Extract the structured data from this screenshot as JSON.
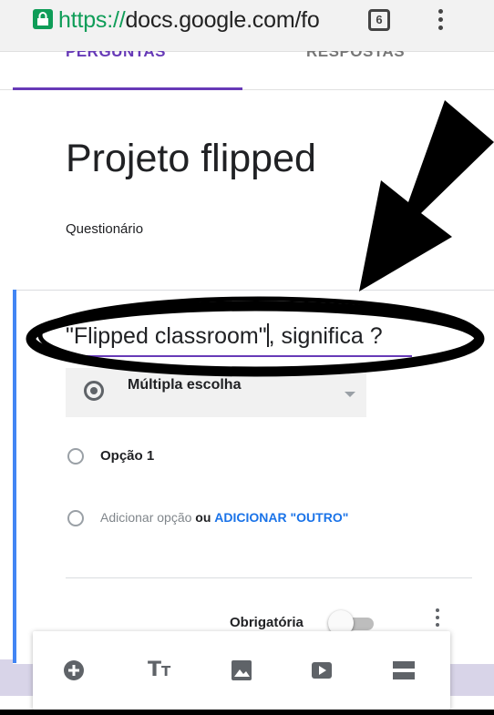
{
  "browser": {
    "url_scheme": "https://",
    "url_host": "docs.google.com/fo",
    "tab_count": "6"
  },
  "form_tabs": {
    "questions": "PERGUNTAS",
    "responses": "RESPOSTAS"
  },
  "form": {
    "title": "Projeto flipped",
    "description": "Questionário"
  },
  "question": {
    "text_part1": "\"Flipped classroom\"",
    "text_part2": ", significa ?",
    "type_label": "Múltipla escolha",
    "option_1": "Opção 1",
    "add_option": "Adicionar opção",
    "or_label": "ou",
    "add_other": "ADICIONAR \"OUTRO\"",
    "required_label": "Obrigatória"
  },
  "colors": {
    "accent": "#673ab7",
    "card_left_bar": "#4285f4",
    "lock_green": "#0f9d58",
    "link_blue": "#1a73e8"
  },
  "icons": {
    "lock": "lock-icon",
    "menu": "more-vert-icon",
    "add_question": "add-circle-icon",
    "title_text": "title-icon",
    "image": "image-icon",
    "video": "video-icon",
    "section": "section-icon"
  }
}
